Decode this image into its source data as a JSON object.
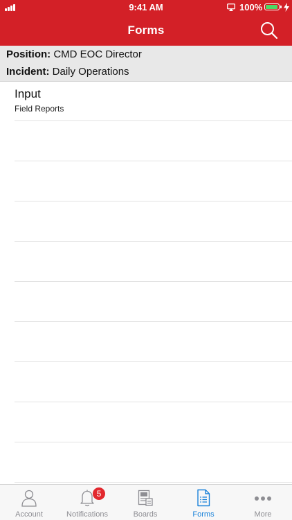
{
  "status_bar": {
    "time": "9:41 AM",
    "battery_percent": "100%",
    "battery_level": 1.0,
    "icons": [
      "signal-icon",
      "airplay-icon",
      "battery-icon",
      "charging-bolt-icon"
    ]
  },
  "nav": {
    "title": "Forms",
    "search_icon": "search-icon"
  },
  "context": {
    "position_label": "Position:",
    "position_value": "CMD EOC Director",
    "incident_label": "Incident:",
    "incident_value": "Daily Operations"
  },
  "list": {
    "items": [
      {
        "title": "Input",
        "subtitle": "Field Reports"
      },
      {
        "title": "",
        "subtitle": ""
      },
      {
        "title": "",
        "subtitle": ""
      },
      {
        "title": "",
        "subtitle": ""
      },
      {
        "title": "",
        "subtitle": ""
      },
      {
        "title": "",
        "subtitle": ""
      },
      {
        "title": "",
        "subtitle": ""
      },
      {
        "title": "",
        "subtitle": ""
      },
      {
        "title": "",
        "subtitle": ""
      },
      {
        "title": "",
        "subtitle": ""
      }
    ]
  },
  "tabbar": {
    "tabs": [
      {
        "label": "Account",
        "icon": "person-icon",
        "active": false
      },
      {
        "label": "Notifications",
        "icon": "bell-icon",
        "active": false,
        "badge": "5"
      },
      {
        "label": "Boards",
        "icon": "boards-icon",
        "active": false
      },
      {
        "label": "Forms",
        "icon": "form-document-icon",
        "active": true
      },
      {
        "label": "More",
        "icon": "more-dots-icon",
        "active": false
      }
    ]
  },
  "colors": {
    "header_red": "#d32027",
    "context_gray": "#e8e8e8",
    "tab_active_blue": "#1a82d9",
    "tab_inactive_gray": "#8e8e93",
    "badge_red": "#e2282e",
    "battery_green": "#4cd964"
  }
}
